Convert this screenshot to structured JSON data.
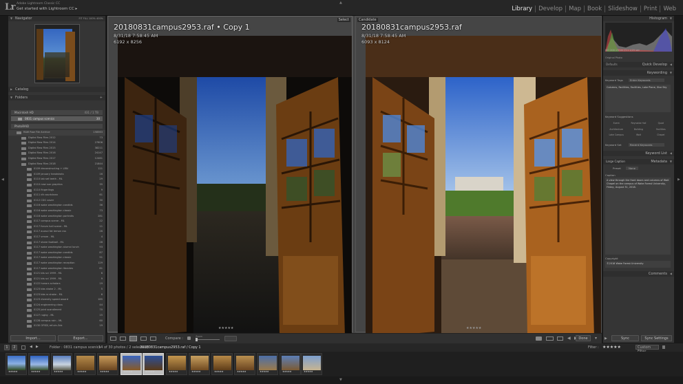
{
  "app": {
    "logo": "Lr",
    "identity_line1": "Adobe Lightroom Classic CC",
    "identity_line2": "Get started with Lightroom CC ▸",
    "modules": [
      "Library",
      "Develop",
      "Map",
      "Book",
      "Slideshow",
      "Print",
      "Web"
    ],
    "active_module": "Library"
  },
  "left_panel": {
    "navigator_title": "Navigator",
    "navigator_opts": "FIT  FILL  100%  400%",
    "catalog_title": "Catalog",
    "folders_title": "Folders",
    "volume1": "Macintosh HD",
    "volume1_info": "431 / 1 TB",
    "volume1_folder": "0831 campus scenics",
    "volume1_count": "30",
    "volume2": "PhotoRAID",
    "volume2_info": "",
    "folders": [
      {
        "label": "RAW Raw File Archive",
        "count": "158563",
        "top": true
      },
      {
        "label": "Digital Raw Files 2012",
        "count": "73"
      },
      {
        "label": "Digital Raw Files 2014",
        "count": "27606"
      },
      {
        "label": "Digital Raw Files 2015",
        "count": "38211"
      },
      {
        "label": "Digital Raw Files 2016",
        "count": "24147"
      },
      {
        "label": "Digital Raw Files 2017",
        "count": "12461"
      },
      {
        "label": "Digital Raw Files 2018",
        "count": "21844"
      },
      {
        "label": "0109 deconstructing + LRN",
        "count": "121",
        "sub": true
      },
      {
        "label": "0109 january headshots",
        "count": "16",
        "sub": true
      },
      {
        "label": "0110 lab set teeth - ML",
        "count": "29",
        "sub": true
      },
      {
        "label": "0110 new sun graphics",
        "count": "35",
        "sub": true
      },
      {
        "label": "0110 fingerlings",
        "count": "9",
        "sub": true
      },
      {
        "label": "0111 dh courtclean",
        "count": "61",
        "sub": true
      },
      {
        "label": "0112 CDC cover",
        "count": "30",
        "sub": true
      },
      {
        "label": "0116 wake washington candids",
        "count": "36",
        "sub": true
      },
      {
        "label": "0116 wake washington classic",
        "count": "73",
        "sub": true
      },
      {
        "label": "0116 wake washington portraits",
        "count": "281",
        "sub": true
      },
      {
        "label": "0117 campus scene - ML",
        "count": "22",
        "sub": true
      },
      {
        "label": "0117 forum hall scene - ML",
        "count": "11",
        "sub": true
      },
      {
        "label": "0117 auxsci fat lemon css",
        "count": "26",
        "sub": true
      },
      {
        "label": "0117 vmsm - ML",
        "count": "4",
        "sub": true
      },
      {
        "label": "0117 stone football - ML",
        "count": "28",
        "sub": true
      },
      {
        "label": "0117 wake washington alumni lunch",
        "count": "93",
        "sub": true
      },
      {
        "label": "0117 wake washington candids",
        "count": "87",
        "sub": true
      },
      {
        "label": "0117 wake washington classic",
        "count": "91",
        "sub": true
      },
      {
        "label": "0117 wake washington reception",
        "count": "129",
        "sub": true
      },
      {
        "label": "0117 wake washington libraries",
        "count": "81",
        "sub": true
      },
      {
        "label": "0121 bts sci 1999 - ML",
        "count": "6",
        "sub": true
      },
      {
        "label": "0121 bts sci 1999 - ML",
        "count": "9",
        "sub": true
      },
      {
        "label": "0122 honors scholars",
        "count": "19",
        "sub": true
      },
      {
        "label": "0123 bbs shake 2 - ML",
        "count": "5",
        "sub": true
      },
      {
        "label": "0123 bbs rx shake - ML",
        "count": "6",
        "sub": true
      },
      {
        "label": "0123 diversity speed award",
        "count": "185",
        "sub": true
      },
      {
        "label": "0124 engineering class",
        "count": "44",
        "sub": true
      },
      {
        "label": "0125 joint scandiment",
        "count": "70",
        "sub": true
      },
      {
        "label": "0127 rugby - ML",
        "count": "15",
        "sub": true
      },
      {
        "label": "0128 campus rain - ML",
        "count": "60",
        "sub": true
      },
      {
        "label": "0130 OFSD\\ ref-vin-3dc",
        "count": "19",
        "sub": true
      }
    ],
    "import_label": "Import...",
    "export_label": "Export..."
  },
  "compare": {
    "select_badge": "Select",
    "candidate_badge": "Candidate",
    "left": {
      "filename": "20180831campus2953.raf • Copy 1",
      "datetime": "8/31/18 7:58:45 AM",
      "dimensions": "6192 x 8256"
    },
    "right": {
      "filename": "20180831campus2953.raf",
      "datetime": "8/31/18 7:58:45 AM",
      "dimensions": "6093 x 8124"
    }
  },
  "toolbar": {
    "compare_label": "Compare :",
    "zoom_label": "Zoom",
    "done_label": "Done"
  },
  "right_panel": {
    "histogram_title": "Histogram",
    "histogram_info": "ISO 200   17mm   f/11   1/25 sec",
    "original_photo": "Original Photo",
    "defaults_label": "Defaults",
    "quick_develop_title": "Quick Develop",
    "keywording_title": "Keywording",
    "keyword_tags_label": "Keyword Tags",
    "keyword_tags_value": "Enter Keywords",
    "keywords_text": "Columns, Facilities, Facilities, Lake Plane, Star Sky",
    "keyword_suggestions_label": "Keyword Suggestions",
    "suggestions": [
      "Event",
      "Reynolda Hall",
      "Quad",
      "Architecture",
      "Building",
      "Facilities",
      "Lake Campus",
      "Wait",
      "Chapel"
    ],
    "keyword_set_label": "Keyword Set",
    "keyword_set_value": "Recent Keywords",
    "keyword_list_title": "Keyword List",
    "large_caption_label": "Large Caption",
    "metadata_title": "Metadata",
    "preset_label": "Preset",
    "preset_value": "None",
    "caption_label": "Caption",
    "caption_text": "A view through the front doors and columns of Wait Chapel on the campus of Wake Forest University, Friday, August 31, 2018.",
    "copyright_label": "Copyright",
    "copyright_text": "©2018 Wake Forest University",
    "comments_title": "Comments",
    "sync_label": "Sync",
    "sync_settings_label": "Sync Settings"
  },
  "filmstrip": {
    "pages": [
      "1",
      "2"
    ],
    "path": "Folder : 0831 campus scenics",
    "photo_count": "14 of 30 photos / 2 selected /",
    "current_file": "20180831campus2953.raf / Copy 1",
    "filter_label": "Filter :",
    "filter_value": "Custom Filter",
    "star_rating": "★★★★★"
  },
  "colors": {
    "panel_bg": "#353535",
    "center_bg": "#464646",
    "sky": "#2c5db8",
    "wood": "#8a5a24"
  }
}
